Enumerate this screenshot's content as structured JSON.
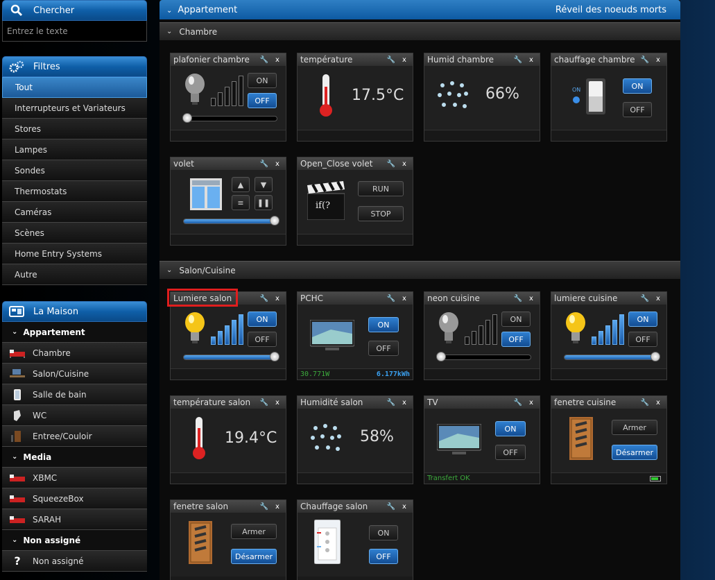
{
  "search": {
    "title": "Chercher",
    "placeholder": "Entrez le texte"
  },
  "filters": {
    "title": "Filtres",
    "items": [
      "Tout",
      "Interrupteurs et Variateurs",
      "Stores",
      "Lampes",
      "Sondes",
      "Thermostats",
      "Caméras",
      "Scènes",
      "Home Entry Systems",
      "Autre"
    ],
    "active": "Tout"
  },
  "house": {
    "title": "La Maison",
    "tree": [
      {
        "type": "group",
        "label": "Appartement"
      },
      {
        "type": "room",
        "label": "Chambre",
        "icon": "bed-icon"
      },
      {
        "type": "room",
        "label": "Salon/Cuisine",
        "icon": "desk-icon"
      },
      {
        "type": "room",
        "label": "Salle de bain",
        "icon": "bath-icon"
      },
      {
        "type": "room",
        "label": "WC",
        "icon": "toilet-icon"
      },
      {
        "type": "room",
        "label": "Entree/Couloir",
        "icon": "door-icon"
      },
      {
        "type": "group",
        "label": "Media"
      },
      {
        "type": "room",
        "label": "XBMC",
        "icon": "bed-icon"
      },
      {
        "type": "room",
        "label": "SqueezeBox",
        "icon": "bed-icon"
      },
      {
        "type": "room",
        "label": "SARAH",
        "icon": "bed-icon"
      },
      {
        "type": "group",
        "label": "Non assigné"
      },
      {
        "type": "room",
        "label": "Non assigné",
        "icon": "question-icon"
      }
    ]
  },
  "main": {
    "title": "Appartement",
    "action": "Réveil des noeuds morts",
    "sections": [
      "Chambre",
      "Salon/Cuisine"
    ]
  },
  "cards": {
    "plafonier": {
      "title": "plafonier chambre",
      "on": "ON",
      "off": "OFF",
      "state": "off",
      "level": 0
    },
    "temperature": {
      "title": "température",
      "value": "17.5°C"
    },
    "humid": {
      "title": "Humid chambre",
      "value": "66%"
    },
    "chauffage": {
      "title": "chauffage chambre",
      "on": "ON",
      "off": "OFF",
      "state": "on",
      "indicator": "ON"
    },
    "volet": {
      "title": "volet",
      "level": 100
    },
    "openclose": {
      "title": "Open_Close volet",
      "run": "RUN",
      "stop": "STOP",
      "icon_text": "if(?"
    },
    "lumiere_salon": {
      "title": "Lumiere salon",
      "on": "ON",
      "off": "OFF",
      "state": "on",
      "level": 100
    },
    "pchc": {
      "title": "PCHC",
      "on": "ON",
      "off": "OFF",
      "state": "on",
      "power": "30.771W",
      "energy": "6.177kWh"
    },
    "neon": {
      "title": "neon cuisine",
      "on": "ON",
      "off": "OFF",
      "state": "off",
      "level": 0
    },
    "lumiere_cuisine": {
      "title": "lumiere cuisine",
      "on": "ON",
      "off": "OFF",
      "state": "on",
      "level": 100
    },
    "temp_salon": {
      "title": "température salon",
      "value": "19.4°C"
    },
    "humid_salon": {
      "title": "Humidité salon",
      "value": "58%"
    },
    "tv": {
      "title": "TV",
      "on": "ON",
      "off": "OFF",
      "state": "on",
      "status": "Transfert OK"
    },
    "fenetre_cuisine": {
      "title": "fenetre cuisine",
      "arm": "Armer",
      "disarm": "Désarmer"
    },
    "fenetre_salon": {
      "title": "fenetre salon",
      "arm": "Armer",
      "disarm": "Désarmer"
    },
    "chauffage_salon": {
      "title": "Chauffage salon",
      "on": "ON",
      "off": "OFF",
      "state": "off"
    }
  },
  "colors": {
    "accent": "#1c6cc0",
    "green_text": "#3caa3c",
    "blue_text": "#3aa0f0",
    "highlight": "#e01e1e"
  }
}
